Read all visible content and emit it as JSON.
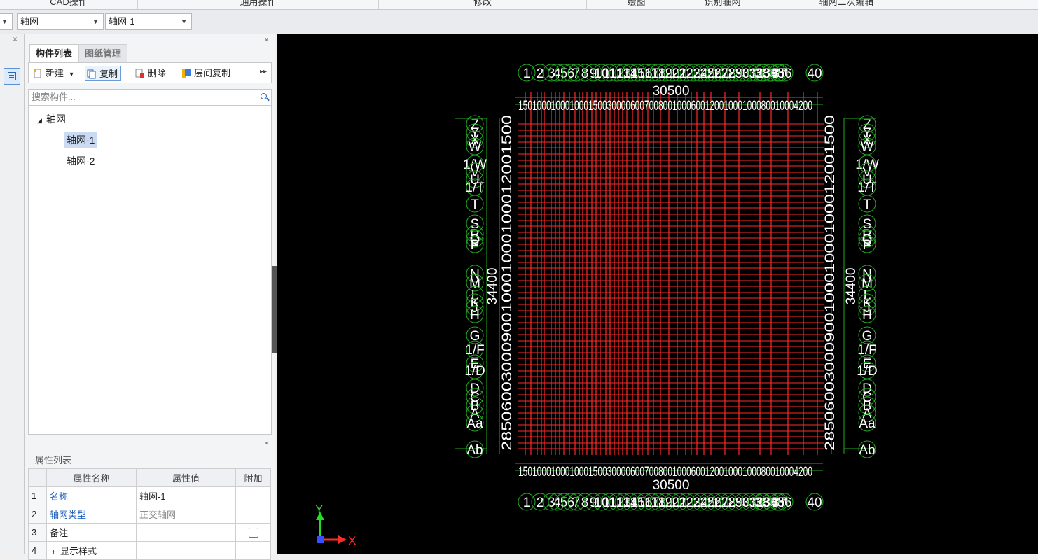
{
  "ribbon": {
    "groups": [
      "CAD操作",
      "通用操作",
      "修改",
      "绘图",
      "识别轴网",
      "轴网二次编辑"
    ]
  },
  "toolbar": {
    "dropdown1_value": "轴网",
    "dropdown2_value": "轴网-1"
  },
  "component_panel": {
    "tabs": [
      "构件列表",
      "图纸管理"
    ],
    "buttons": {
      "new": "新建",
      "copy": "复制",
      "delete": "删除",
      "floor_copy": "层间复制"
    },
    "search_placeholder": "搜索构件...",
    "tree": {
      "root": "轴网",
      "children": [
        "轴网-1",
        "轴网-2"
      ]
    }
  },
  "property_panel": {
    "title": "属性列表",
    "headers": [
      "属性名称",
      "属性值",
      "附加"
    ],
    "rows": [
      {
        "num": "1",
        "name": "名称",
        "value": "轴网-1"
      },
      {
        "num": "2",
        "name": "轴网类型",
        "value": "正交轴网"
      },
      {
        "num": "3",
        "name": "备注",
        "value": ""
      },
      {
        "num": "4",
        "name": "显示样式",
        "value": ""
      }
    ]
  },
  "canvas": {
    "top_axis_labels": [
      "1",
      "2",
      "3",
      "4",
      "5",
      "6",
      "7",
      "8",
      "9",
      "10",
      "11",
      "12",
      "13",
      "14",
      "15",
      "16",
      "17",
      "18",
      "19",
      "20",
      "21",
      "22",
      "23",
      "24",
      "25",
      "26",
      "27",
      "28",
      "29",
      "30",
      "31",
      "32",
      "33",
      "34",
      "35",
      "36",
      "37",
      "38",
      "39",
      "40"
    ],
    "top_total_dim": "30500",
    "top_seg_dims_text": "150100010001000150030000600700800100060012001000100080010004200",
    "bottom_total_dim": "30500",
    "bottom_seg_dims_text": "150100010001000150030000600700800100060012001000100080010004200",
    "side_axis_labels": [
      "Z",
      "Y",
      "X",
      "W",
      "1/W",
      "V",
      "U",
      "1/T",
      "T",
      "S",
      "R",
      "Q",
      "P",
      "N",
      "M",
      "L",
      "K",
      "J",
      "H",
      "G",
      "1/F",
      "E",
      "1/D",
      "D",
      "C",
      "B",
      "A",
      "Aa",
      "Ab"
    ],
    "left_total_dim": "34400",
    "right_total_dim": "34400",
    "side_seg_dims_text": "2850600300090010001000100012001500",
    "ucs": {
      "x_label": "X",
      "y_label": "Y"
    },
    "colors": {
      "grid": "#ff2a2a",
      "dims": "#22aa22",
      "text": "#ffffff",
      "background": "#000000"
    }
  }
}
